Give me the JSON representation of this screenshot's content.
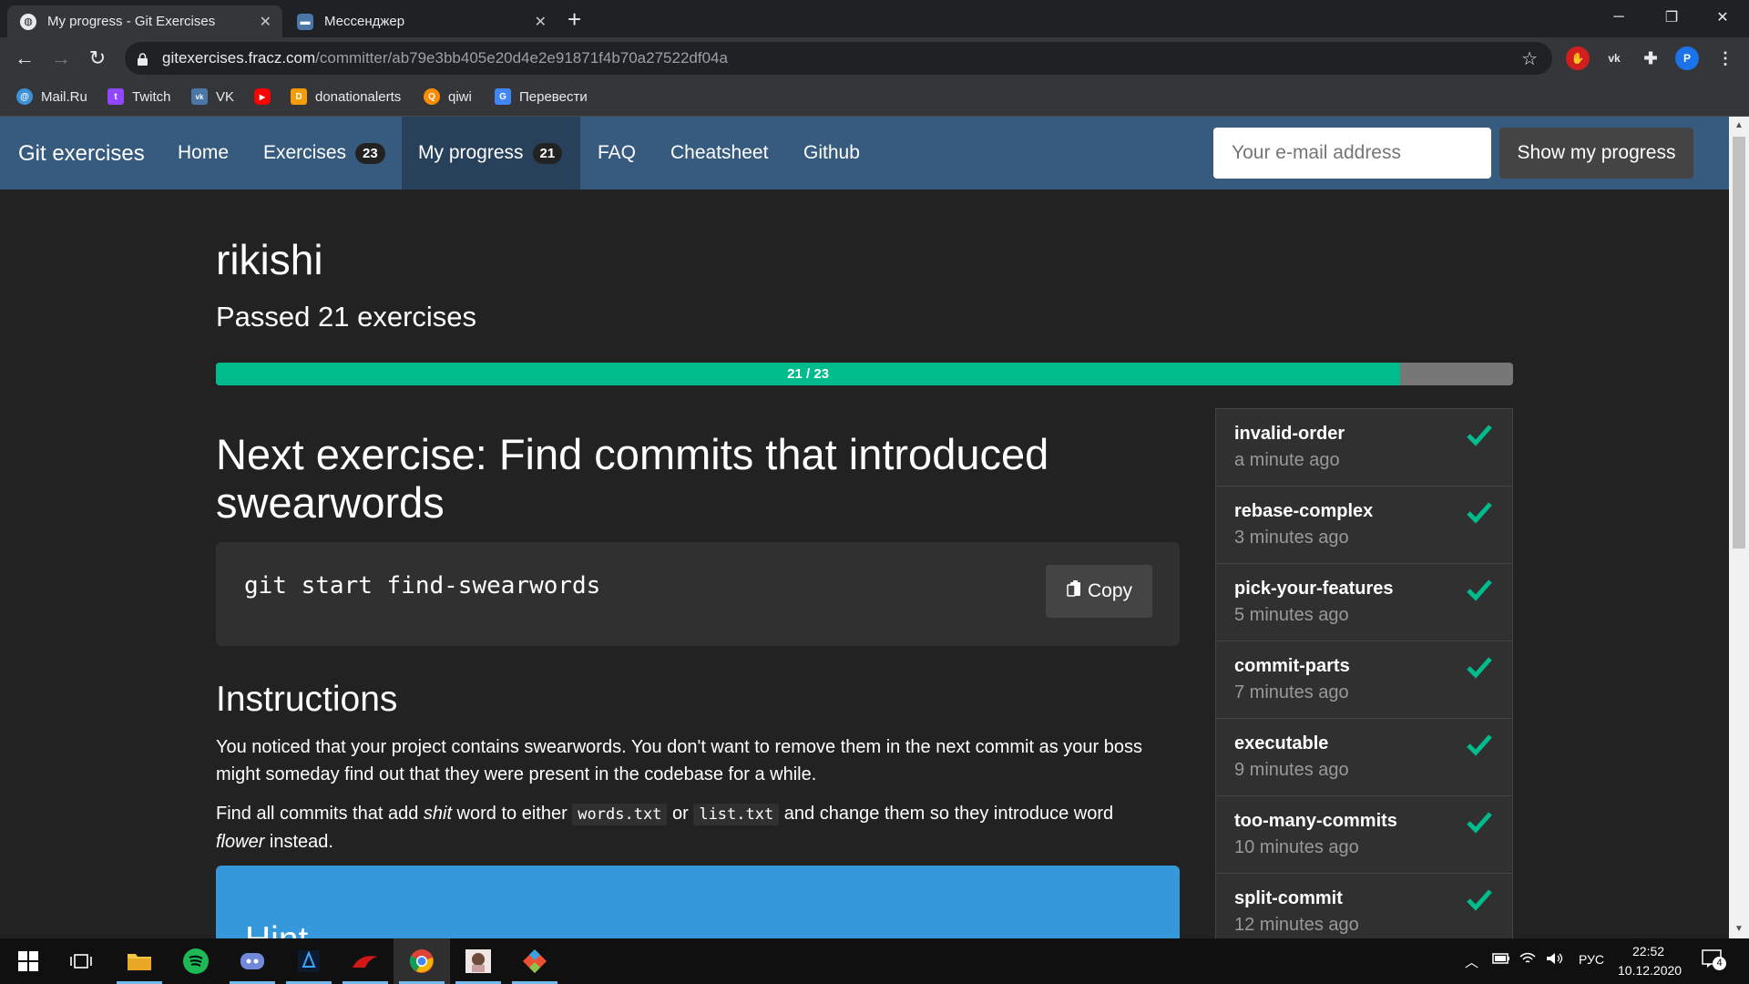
{
  "browser": {
    "tabs": [
      {
        "title": "My progress - Git Exercises",
        "active": true
      },
      {
        "title": "Мессенджер",
        "active": false
      }
    ],
    "new_tab": "+",
    "window_controls": {
      "minimize": "─",
      "restore": "❐",
      "close": "✕"
    },
    "url_host": "gitexercises.fracz.com",
    "url_path": "/committer/ab79e3bb405e20d4e2e91871f4b70a27522df04a",
    "profile_initial": "P",
    "bookmarks": [
      {
        "label": "Mail.Ru",
        "icon": "mailru-icon",
        "color": "#3d8fd6",
        "glyph": "@"
      },
      {
        "label": "Twitch",
        "icon": "twitch-icon",
        "color": "#9146ff",
        "glyph": "t"
      },
      {
        "label": "VK",
        "icon": "vk-icon",
        "color": "#4a76a8",
        "glyph": "vk"
      },
      {
        "label": "",
        "icon": "youtube-icon",
        "color": "#ff0000",
        "glyph": "▶"
      },
      {
        "label": "donationalerts",
        "icon": "donationalerts-icon",
        "color": "#f59c07",
        "glyph": "D"
      },
      {
        "label": "qiwi",
        "icon": "qiwi-icon",
        "color": "#ff8c00",
        "glyph": "Q"
      },
      {
        "label": "Перевести",
        "icon": "translate-icon",
        "color": "#4285f4",
        "glyph": "G"
      }
    ]
  },
  "site": {
    "brand": "Git exercises",
    "nav": [
      {
        "label": "Home",
        "badge": null,
        "active": false
      },
      {
        "label": "Exercises",
        "badge": "23",
        "active": false
      },
      {
        "label": "My progress",
        "badge": "21",
        "active": true
      },
      {
        "label": "FAQ",
        "badge": null,
        "active": false
      },
      {
        "label": "Cheatsheet",
        "badge": null,
        "active": false
      },
      {
        "label": "Github",
        "badge": null,
        "active": false
      }
    ],
    "email_placeholder": "Your e-mail address",
    "show_button": "Show my progress"
  },
  "main": {
    "username": "rikishi",
    "passed": "Passed 21 exercises",
    "progress": {
      "label": "21 / 23",
      "done": 21,
      "total": 23
    },
    "next_heading": "Next exercise: Find commits that introduced swearwords",
    "command": "git start find-swearwords",
    "copy_label": "Copy",
    "instructions_heading": "Instructions",
    "para1": "You noticed that your project contains swearwords. You don't want to remove them in the next commit as your boss might someday find out that they were present in the codebase for a while.",
    "para2": {
      "p1": "Find all commits that add ",
      "em1": "shit",
      "p2": " word to either ",
      "code1": "words.txt",
      "p3": " or ",
      "code2": "list.txt",
      "p4": " and change them so they introduce word ",
      "em2": "flower",
      "p5": " instead."
    },
    "hint_title": "Hint"
  },
  "completed": [
    {
      "name": "invalid-order",
      "time": "a minute ago"
    },
    {
      "name": "rebase-complex",
      "time": "3 minutes ago"
    },
    {
      "name": "pick-your-features",
      "time": "5 minutes ago"
    },
    {
      "name": "commit-parts",
      "time": "7 minutes ago"
    },
    {
      "name": "executable",
      "time": "9 minutes ago"
    },
    {
      "name": "too-many-commits",
      "time": "10 minutes ago"
    },
    {
      "name": "split-commit",
      "time": "12 minutes ago"
    }
  ],
  "colors": {
    "success": "#00bc8c",
    "navbar": "#375a7f",
    "hint": "#3498db"
  },
  "taskbar": {
    "apps": [
      "windows-start-icon",
      "task-view-icon",
      "file-explorer-icon",
      "spotify-icon",
      "discord-icon",
      "battlenet-icon",
      "razer-icon",
      "chrome-icon",
      "anime-app-icon",
      "git-icon"
    ],
    "lang": "РУС",
    "time": "22:52",
    "date": "10.12.2020",
    "notifications": "4"
  }
}
